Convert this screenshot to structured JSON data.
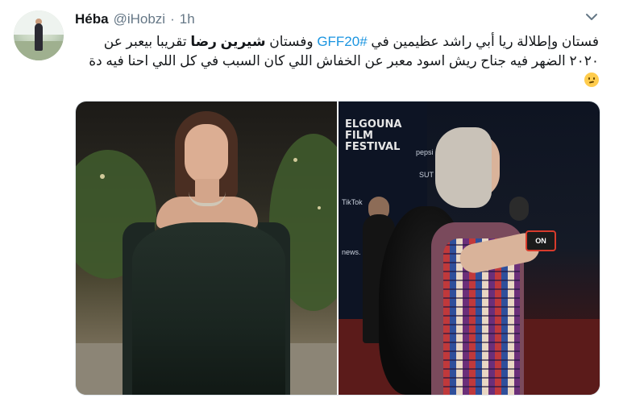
{
  "user": {
    "display_name": "Héba",
    "handle": "@iHobzi",
    "separator": "·",
    "time": "1h"
  },
  "tweet": {
    "text_part1": "فستان وإطلالة ريا أبي راشد عظيمين في ",
    "hashtag": "#GFF20",
    "text_part2": " وفستان ",
    "bold_name": "شيرين رضا",
    "text_part3": " تقريبا بيعبر عن ٢٠٢٠ الضهر فيه جناح ريش اسود معبر عن الخفاش اللي كان السبب في كل اللي احنا فيه دة"
  },
  "media": {
    "photo_left_name": "photo-gown",
    "photo_right_name": "photo-red-carpet",
    "right_texts": {
      "festival_line1": "ELGOUNA",
      "festival_line2": "FILM",
      "festival_line3": "FESTIVAL",
      "sponsor1": "pepsi",
      "sponsor2": "SUT",
      "sponsor3": "TikTok",
      "sponsor4": "news.",
      "mic_label": "ON"
    }
  },
  "icons": {
    "caret": "chevron-down-icon",
    "emoji": "worried-face-emoji"
  },
  "colors": {
    "link": "#1b95e0",
    "secondary_text": "#657786",
    "primary_text": "#14171a"
  }
}
